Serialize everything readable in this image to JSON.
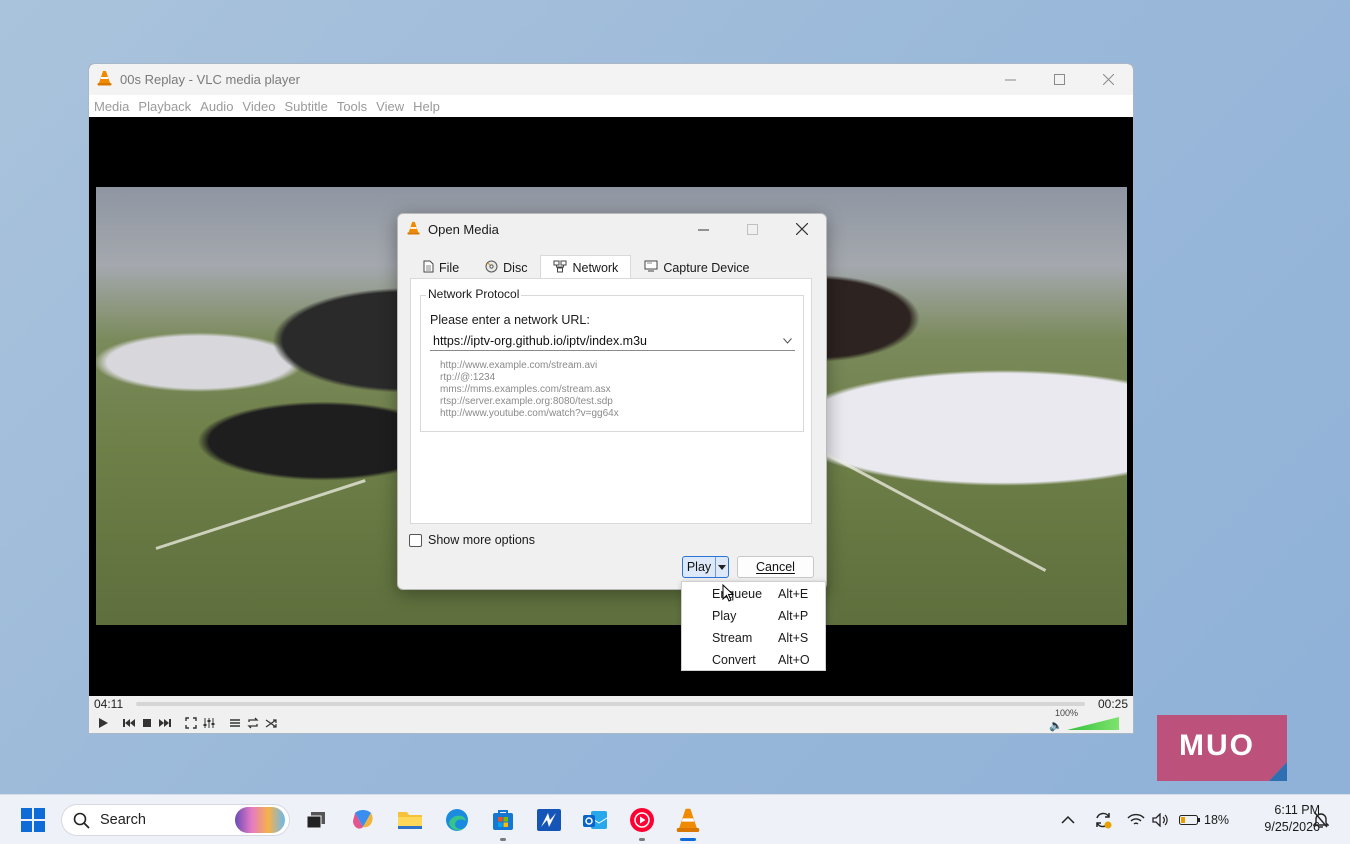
{
  "vlc": {
    "title": "00s Replay - VLC media player",
    "menu": [
      "Media",
      "Playback",
      "Audio",
      "Video",
      "Subtitle",
      "Tools",
      "View",
      "Help"
    ],
    "time_elapsed": "04:11",
    "time_remaining": "00:25",
    "volume_label": "100%",
    "volume_level": 1.0
  },
  "dialog": {
    "title": "Open Media",
    "tabs": [
      {
        "label": "File",
        "icon": "file-icon"
      },
      {
        "label": "Disc",
        "icon": "disc-icon"
      },
      {
        "label": "Network",
        "icon": "network-icon",
        "active": true
      },
      {
        "label": "Capture Device",
        "icon": "capture-device-icon"
      }
    ],
    "group_title": "Network Protocol",
    "url_label": "Please enter a network URL:",
    "url_value": "https://iptv-org.github.io/iptv/index.m3u",
    "examples": [
      "http://www.example.com/stream.avi",
      "rtp://@:1234",
      "mms://mms.examples.com/stream.asx",
      "rtsp://server.example.org:8080/test.sdp",
      "http://www.youtube.com/watch?v=gg64x"
    ],
    "show_more_options": "Show more options",
    "show_more_checked": false,
    "play_label": "Play",
    "cancel_label": "Cancel"
  },
  "play_menu": [
    {
      "label": "Enqueue",
      "accel": "Alt+E"
    },
    {
      "label": "Play",
      "accel": "Alt+P"
    },
    {
      "label": "Stream",
      "accel": "Alt+S"
    },
    {
      "label": "Convert",
      "accel": "Alt+O"
    }
  ],
  "watermark": "MUO",
  "taskbar": {
    "search_placeholder": "Search",
    "battery": "18%",
    "time": "6:11 PM",
    "date": "9/25/2026"
  },
  "colors": {
    "accent": "#0f6cd6",
    "vlc_orange": "#f08a00",
    "muo_bg": "#c04a74"
  }
}
